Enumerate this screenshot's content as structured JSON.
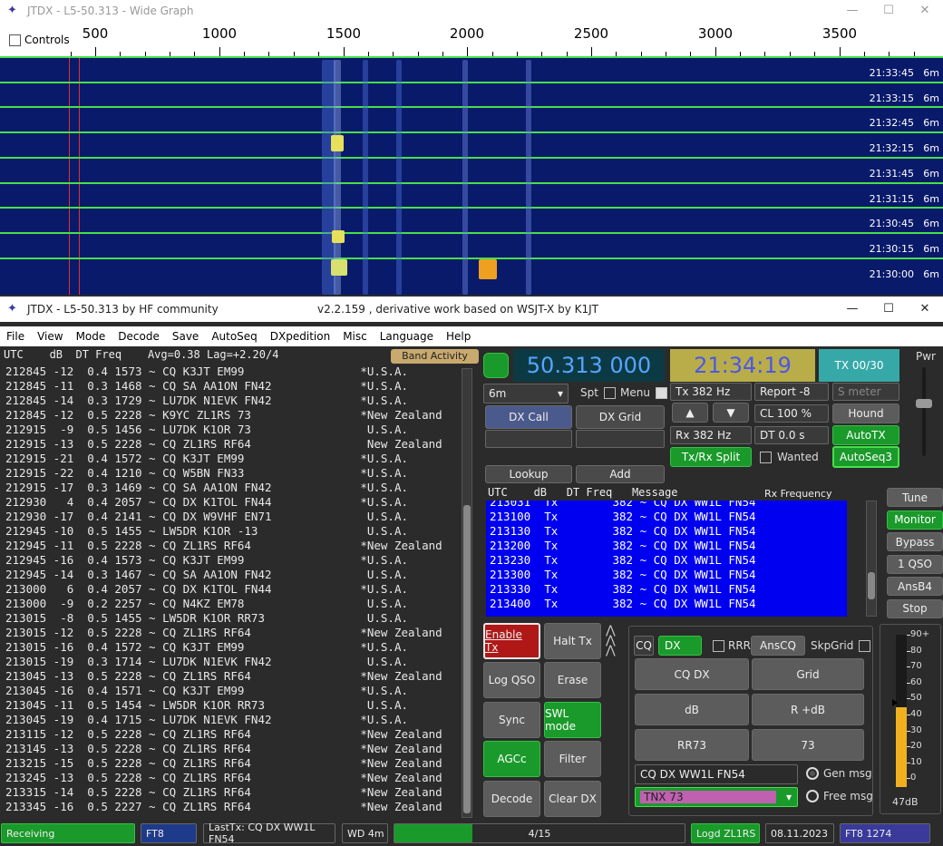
{
  "wide_graph": {
    "title": "JTDX - L5-50.313 - Wide Graph",
    "controls_label": "Controls",
    "scale_labels": [
      "500",
      "1000",
      "1500",
      "2000",
      "2500",
      "3000",
      "3500"
    ],
    "bands": [
      {
        "time": "21:33:45",
        "band": "6m"
      },
      {
        "time": "21:33:15",
        "band": "6m"
      },
      {
        "time": "21:32:45",
        "band": "6m"
      },
      {
        "time": "21:32:15",
        "band": "6m"
      },
      {
        "time": "21:31:45",
        "band": "6m"
      },
      {
        "time": "21:31:15",
        "band": "6m"
      },
      {
        "time": "21:30:45",
        "band": "6m"
      },
      {
        "time": "21:30:15",
        "band": "6m"
      },
      {
        "time": "21:30:00",
        "band": "6m"
      }
    ]
  },
  "main_window": {
    "title": "JTDX - L5-50.313  by HF community",
    "subtitle": "v2.2.159 , derivative work based on WSJT-X by K1JT"
  },
  "menu": [
    "File",
    "View",
    "Mode",
    "Decode",
    "Save",
    "AutoSeq",
    "DXpedition",
    "Misc",
    "Language",
    "Help"
  ],
  "band_activity": {
    "header": "UTC    dB  DT Freq    Avg=0.38 Lag=+2.20/4",
    "button_label": "Band Activity",
    "rows": [
      "212845 -12  0.4 1573 ~ CQ K3JT EM99                 *U.S.A.",
      "212845 -11  0.3 1468 ~ CQ SA AA1ON FN42             *U.S.A.",
      "212845 -14  0.3 1729 ~ LU7DK N1EVK FN42             *U.S.A.",
      "212845 -12  0.5 2228 ~ K9YC ZL1RS 73                *New Zealand",
      "212915  -9  0.5 1456 ~ LU7DK K1OR 73                 U.S.A.",
      "212915 -13  0.5 2228 ~ CQ ZL1RS RF64                 New Zealand",
      "212915 -21  0.4 1572 ~ CQ K3JT EM99                 *U.S.A.",
      "212915 -22  0.4 1210 ~ CQ W5BN FN33                 *U.S.A.",
      "212915 -17  0.3 1469 ~ CQ SA AA1ON FN42             *U.S.A.",
      "212930   4  0.4 2057 ~ CQ DX K1TOL FN44             *U.S.A.",
      "212930 -17  0.4 2141 ~ CQ DX W9VHF EN71              U.S.A.",
      "212945 -10  0.5 1455 ~ LW5DR K1OR -13                U.S.A.",
      "212945 -11  0.5 2228 ~ CQ ZL1RS RF64                *New Zealand",
      "212945 -16  0.4 1573 ~ CQ K3JT EM99                 *U.S.A.",
      "212945 -14  0.3 1467 ~ CQ SA AA1ON FN42              U.S.A.",
      "213000   6  0.4 2057 ~ CQ DX K1TOL FN44             *U.S.A.",
      "213000  -9  0.2 2257 ~ CQ N4KZ EM78                  U.S.A.",
      "213015  -8  0.5 1455 ~ LW5DR K1OR RR73               U.S.A.",
      "213015 -12  0.5 2228 ~ CQ ZL1RS RF64                *New Zealand",
      "213015 -16  0.4 1572 ~ CQ K3JT EM99                 *U.S.A.",
      "213015 -19  0.3 1714 ~ LU7DK N1EVK FN42              U.S.A.",
      "213045 -13  0.5 2228 ~ CQ ZL1RS RF64                *New Zealand",
      "213045 -16  0.4 1571 ~ CQ K3JT EM99                 *U.S.A.",
      "213045 -11  0.5 1454 ~ LW5DR K1OR RR73               U.S.A.",
      "213045 -19  0.4 1715 ~ LU7DK N1EVK FN42             *U.S.A.",
      "213115 -12  0.5 2228 ~ CQ ZL1RS RF64                *New Zealand",
      "213145 -13  0.5 2228 ~ CQ ZL1RS RF64                *New Zealand",
      "213215 -15  0.5 2228 ~ CQ ZL1RS RF64                *New Zealand",
      "213245 -13  0.5 2228 ~ CQ ZL1RS RF64                *New Zealand",
      "213315 -14  0.5 2228 ~ CQ ZL1RS RF64                *New Zealand",
      "213345 -16  0.5 2227 ~ CQ ZL1RS RF64                *New Zealand"
    ]
  },
  "controls": {
    "frequency": "50.313 000",
    "clock": "21:34:19",
    "tx_counter": "TX 00/30",
    "band": "6m",
    "spt": "Spt",
    "menu_label": "Menu",
    "dx_call": "DX Call",
    "dx_grid": "DX Grid",
    "tx_hz": "Tx  382 Hz",
    "rx_hz": "Rx  382 Hz",
    "report": "Report -8",
    "s_meter": "S meter",
    "cl": "CL  100 %",
    "dt": "DT 0.0 s",
    "hound": "Hound",
    "autotx": "AutoTX",
    "autoseq3": "AutoSeq3",
    "txrx_split": "Tx/Rx Split",
    "wanted": "Wanted",
    "lookup": "Lookup",
    "add": "Add",
    "pwr": "Pwr"
  },
  "rx_freq": {
    "header": "UTC    dB   DT Freq   Message",
    "header_right": "Rx Frequency",
    "rows": [
      "213031  Tx        382 ~ CQ DX WW1L FN54",
      "213100  Tx        382 ~ CQ DX WW1L FN54",
      "213130  Tx        382 ~ CQ DX WW1L FN54",
      "213200  Tx        382 ~ CQ DX WW1L FN54",
      "213230  Tx        382 ~ CQ DX WW1L FN54",
      "213300  Tx        382 ~ CQ DX WW1L FN54",
      "213330  Tx        382 ~ CQ DX WW1L FN54",
      "213400  Tx        382 ~ CQ DX WW1L FN54"
    ]
  },
  "side_buttons": [
    "Tune",
    "Monitor",
    "Bypass",
    "1 QSO",
    "AnsB4",
    "Stop"
  ],
  "action_buttons": {
    "enable_tx": "Enable Tx",
    "halt_tx": "Halt Tx",
    "log_qso": "Log QSO",
    "erase": "Erase",
    "sync": "Sync",
    "swl_mode": "SWL mode",
    "agcc": "AGCc",
    "filter": "Filter",
    "decode": "Decode",
    "clear_dx": "Clear DX"
  },
  "tx_panel": {
    "cq": "CQ",
    "dx": "DX",
    "rrr": "RRR",
    "anscq": "AnsCQ",
    "skpgrid": "SkpGrid",
    "cq_dx": "CQ DX",
    "grid": "Grid",
    "db": "dB",
    "r_db": "R +dB",
    "rr73": "RR73",
    "n73": "73",
    "gen_msg_text": "CQ DX WW1L FN54",
    "gen_msg": "Gen msg",
    "free_msg_text": "TNX 73",
    "free_msg": "Free msg"
  },
  "meter": {
    "labels": [
      "90+",
      "80",
      "70",
      "60",
      "50",
      "40",
      "30",
      "20",
      "10",
      "0"
    ],
    "value_label": "47dB",
    "level_db": 47
  },
  "status_bar": {
    "receiving": "Receiving",
    "mode": "FT8",
    "last_tx": "LastTx: CQ DX WW1L FN54",
    "wd": "WD 4m",
    "progress_text": "4/15",
    "progress": 0.27,
    "logged": "Logd ZL1RS",
    "date": "08.11.2023",
    "mode_freq": "FT8  1274"
  },
  "colors": {
    "waterfall_bg": "#0a1a6b",
    "band_line": "#46e04a",
    "rx_list_bg": "#0000f0",
    "enable_tx": "#b01818",
    "accent_green": "#1a9a2a"
  }
}
